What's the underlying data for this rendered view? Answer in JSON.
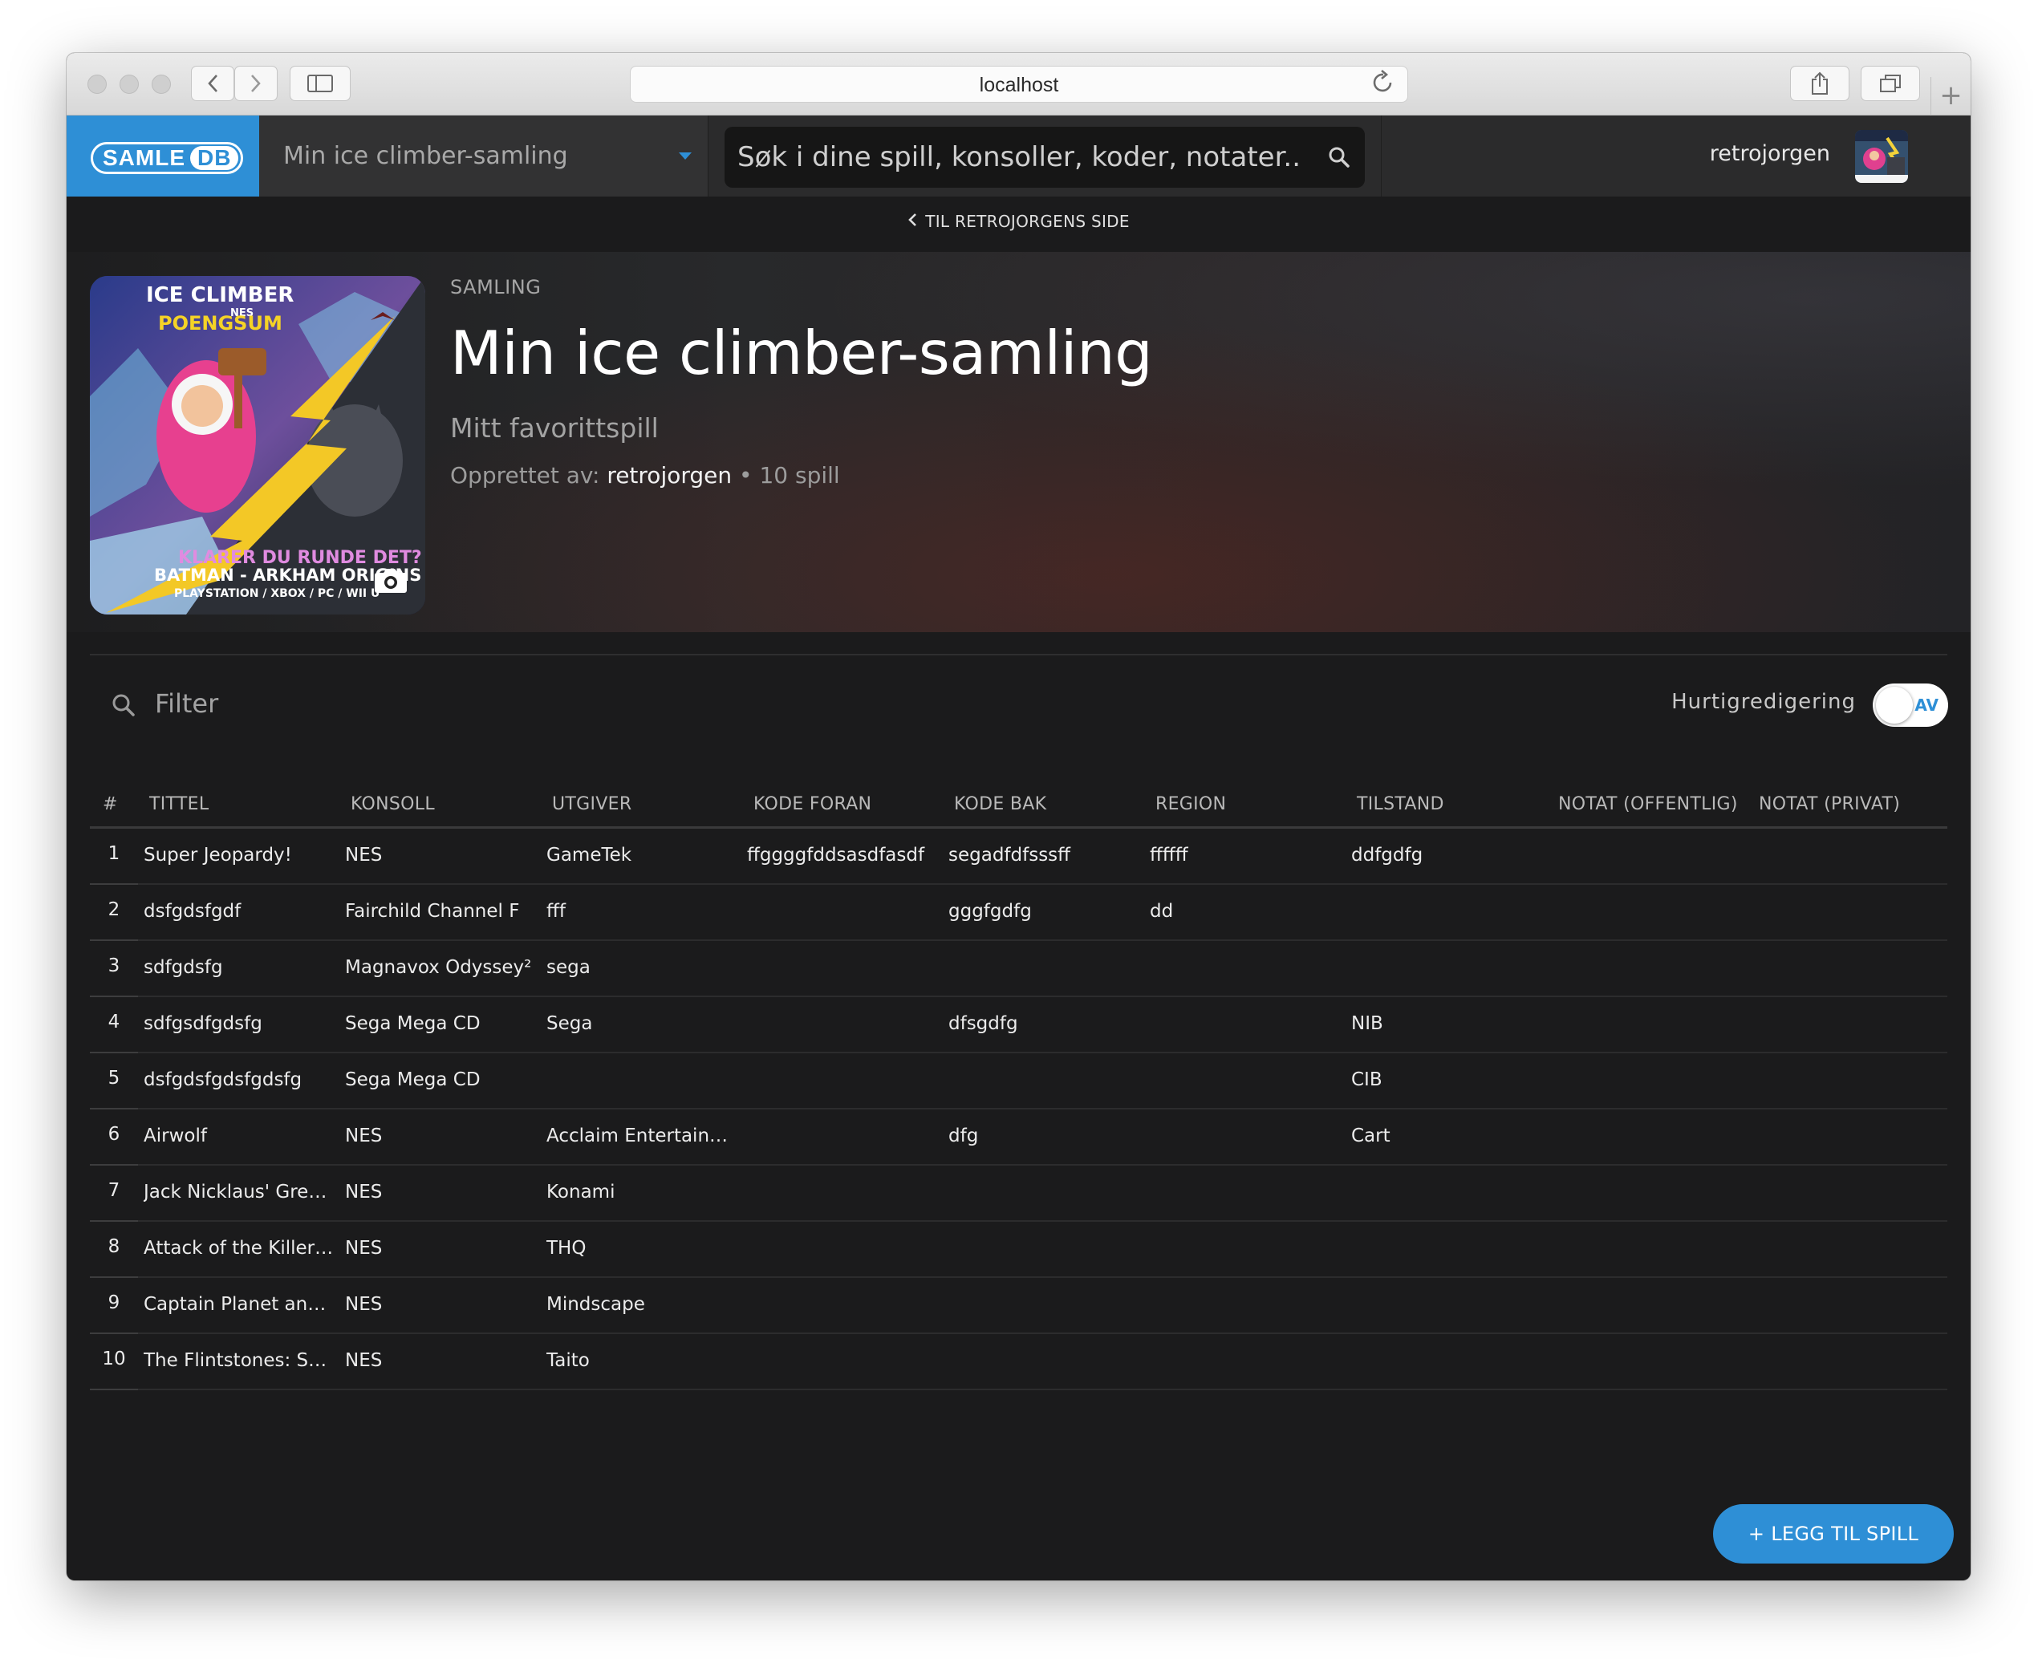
{
  "browser": {
    "url": "localhost"
  },
  "header": {
    "logo_samle": "SAMLE",
    "logo_db": "DB",
    "collection_selector": "Min ice climber-samling",
    "search_placeholder": "Søk i dine spill, konsoller, koder, notater..",
    "username": "retrojorgen"
  },
  "back_link": "TIL RETROJORGENS SIDE",
  "collection": {
    "eyebrow": "SAMLING",
    "title": "Min ice climber-samling",
    "description": "Mitt favorittspill",
    "created_by_label": "Opprettet av:",
    "owner": "retrojorgen",
    "count_text": "• 10 spill",
    "cover": {
      "line1": "ICE CLIMBER",
      "line2": "NES",
      "line3": "POENGSUM",
      "line4": "KLARER DU RUNDE DET?",
      "line5": "BATMAN - ARKHAM ORIGINS",
      "line6": "PLAYSTATION / XBOX / PC / WII U"
    }
  },
  "filter": {
    "placeholder": "Filter",
    "quick_edit_label": "Hurtigredigering",
    "toggle_state": "AV"
  },
  "table": {
    "columns": [
      "#",
      "TITTEL",
      "KONSOLL",
      "UTGIVER",
      "KODE FORAN",
      "KODE BAK",
      "REGION",
      "TILSTAND",
      "NOTAT (OFFENTLIG)",
      "NOTAT (PRIVAT)"
    ],
    "rows": [
      [
        "1",
        "Super Jeopardy!",
        "NES",
        "GameTek",
        "ffggggfddsasdfasdf",
        "segadfdfsssff",
        "ffffff",
        "ddfgdfg",
        "",
        ""
      ],
      [
        "2",
        "dsfgdsfgdf",
        "Fairchild Channel F",
        "fff",
        "",
        "gggfgdfg",
        "dd",
        "",
        "",
        ""
      ],
      [
        "3",
        "sdfgdsfg",
        "Magnavox Odyssey²",
        "sega",
        "",
        "",
        "",
        "",
        "",
        ""
      ],
      [
        "4",
        "sdfgsdfgdsfg",
        "Sega Mega CD",
        "Sega",
        "",
        "dfsgdfg",
        "",
        "NIB",
        "",
        ""
      ],
      [
        "5",
        "dsfgdsfgdsfgdsfg",
        "Sega Mega CD",
        "",
        "",
        "",
        "",
        "CIB",
        "",
        ""
      ],
      [
        "6",
        "Airwolf",
        "NES",
        "Acclaim Entertainment",
        "",
        "dfg",
        "",
        "Cart",
        "",
        ""
      ],
      [
        "7",
        "Jack Nicklaus' Greate...",
        "NES",
        "Konami",
        "",
        "",
        "",
        "",
        "",
        ""
      ],
      [
        "8",
        "Attack of the Killer To...",
        "NES",
        "THQ",
        "",
        "",
        "",
        "",
        "",
        ""
      ],
      [
        "9",
        "Captain Planet and t...",
        "NES",
        "Mindscape",
        "",
        "",
        "",
        "",
        "",
        ""
      ],
      [
        "10",
        "The Flintstones: Surp...",
        "NES",
        "Taito",
        "",
        "",
        "",
        "",
        "",
        ""
      ]
    ]
  },
  "add_button": "+ LEGG TIL SPILL",
  "colors": {
    "accent": "#2e8fd6",
    "background": "#1b1b1c",
    "header": "#2b2b2c"
  }
}
